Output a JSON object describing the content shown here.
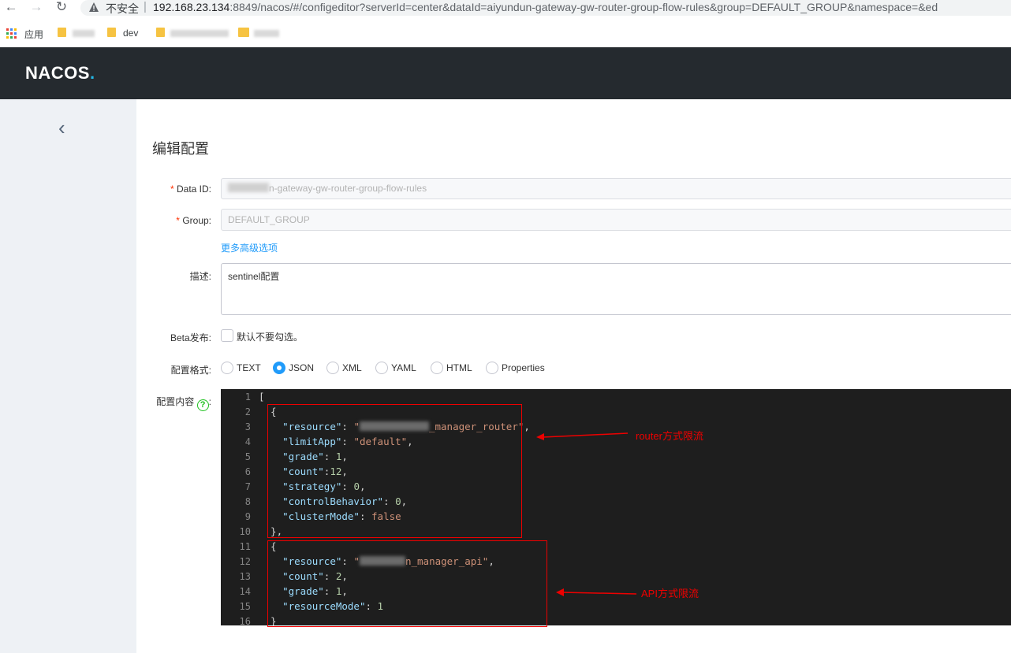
{
  "browser": {
    "insecure_label": "不安全",
    "url_host": "192.168.23.134",
    "url_rest": ":8849/nacos/#/configeditor?serverId=center&dataId=aiyundun-gateway-gw-router-group-flow-rules&group=DEFAULT_GROUP&namespace=&ed",
    "apps_label": "应用",
    "bookmark_dev": "dev"
  },
  "header": {
    "logo_main": "NACOS",
    "logo_dot": "."
  },
  "page": {
    "title": "编辑配置",
    "data_id_label": "Data ID:",
    "data_id_value": "n-gateway-gw-router-group-flow-rules",
    "group_label": "Group:",
    "group_value": "DEFAULT_GROUP",
    "advanced_link": "更多高级选项",
    "desc_label": "描述:",
    "desc_value": "sentinel配置",
    "beta_label": "Beta发布:",
    "beta_hint": "默认不要勾选。",
    "format_label": "配置格式:",
    "formats": [
      "TEXT",
      "JSON",
      "XML",
      "YAML",
      "HTML",
      "Properties"
    ],
    "selected_format": "JSON",
    "content_label": "配置内容",
    "content_colon": ":"
  },
  "editor": {
    "line_numbers": [
      "1",
      "2",
      "3",
      "4",
      "5",
      "6",
      "7",
      "8",
      "9",
      "10",
      "11",
      "12",
      "13",
      "14",
      "15",
      "16"
    ],
    "lines": {
      "l1": "[",
      "l2": "  {",
      "l3_key": "\"resource\"",
      "l3_val_visible": "_manager_router\"",
      "l4_key": "\"limitApp\"",
      "l4_val": "\"default\"",
      "l5_key": "\"grade\"",
      "l5_val": "1",
      "l6_key": "\"count\"",
      "l6_val": "12",
      "l7_key": "\"strategy\"",
      "l7_val": "0",
      "l8_key": "\"controlBehavior\"",
      "l8_val": "0",
      "l9_key": "\"clusterMode\"",
      "l9_val": "false",
      "l10": "  },",
      "l11": "  {",
      "l12_key": "\"resource\"",
      "l12_val_visible": "n_manager_api\"",
      "l13_key": "\"count\"",
      "l13_val": "2",
      "l14_key": "\"grade\"",
      "l14_val": "1",
      "l15_key": "\"resourceMode\"",
      "l15_val": "1",
      "l16": "  }"
    }
  },
  "annotations": {
    "router": "router方式限流",
    "api": "API方式限流"
  },
  "colors": {
    "accent": "#209bfa",
    "annotation": "#ee0000",
    "header_bg": "#252a2f",
    "editor_bg": "#1e1e1e"
  }
}
